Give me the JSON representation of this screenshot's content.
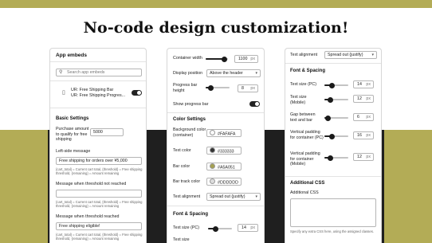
{
  "page": {
    "title": "No-code design customization!"
  },
  "panel1": {
    "title": "App embeds",
    "search_placeholder": "Search app embeds",
    "embed": {
      "title": "UR: Free Shipping Bar",
      "subtitle": "UR: Free Shipping Progres...",
      "enabled": true
    },
    "basic_settings": "Basic Settings",
    "purchase_label": "Purchase amount to qualify for free shipping",
    "purchase_value": "5000",
    "left_msg_label": "Left-side message",
    "left_msg_value": "Free shipping for orders over ¥5,000",
    "left_msg_help": "{cart_total} = Current cart total, {threshold} = Free shipping threshold, {remaining} = Amount remaining",
    "not_reached_label": "Message when threshold not reached",
    "not_reached_help": "{cart_total} = Current cart total, {threshold} = Free shipping threshold, {remaining} = Amount remaining",
    "reached_label": "Message when threshold reached",
    "reached_value": "Free shipping eligible!",
    "reached_help": "{cart_total} = Current cart total, {threshold} = Free shipping threshold, {remaining} = Amount remaining"
  },
  "panel2": {
    "container_width_label": "Container width",
    "container_width_value": "1100",
    "display_position_label": "Display position",
    "display_position_value": "Above the header",
    "progress_height_label": "Progress bar height",
    "progress_height_value": "8",
    "show_progress_label": "Show progress bar",
    "show_progress_enabled": true,
    "color_settings": "Color Settings",
    "bg_color_label": "Background color (container)",
    "bg_color_value": "#FAFAFA",
    "text_color_label": "Text color",
    "text_color_value": "#333333",
    "bar_color_label": "Bar color",
    "bar_color_value": "#A5A051",
    "bar_track_label": "Bar track color",
    "bar_track_value": "#DDDDDD",
    "text_align_label": "Text alignment",
    "text_align_value": "Spread out (justify)",
    "font_spacing": "Font & Spacing",
    "text_size_pc_label": "Text size (PC)",
    "text_size_pc_value": "14",
    "text_size_mobile_label": "Text size",
    "unit": "px"
  },
  "panel3": {
    "text_align_label": "Text alignment",
    "text_align_value": "Spread out (justify)",
    "font_spacing": "Font & Spacing",
    "text_size_pc_label": "Text size (PC)",
    "text_size_pc_value": "14",
    "text_size_mobile_label": "Text size (Mobile)",
    "text_size_mobile_value": "12",
    "gap_label": "Gap between text and bar",
    "gap_value": "6",
    "vpad_pc_label": "Vertical padding for container (PC)",
    "vpad_pc_value": "16",
    "vpad_mobile_label": "Vertical padding for container (Mobile)",
    "vpad_mobile_value": "12",
    "additional_css": "Additional CSS",
    "additional_css_label": "Additional CSS",
    "css_help": "Specify any extra CSS here, using the assigned classes.",
    "unit": "px"
  },
  "colors": {
    "gold": "#b3ac56",
    "dark": "#1f1f1f",
    "bg": "#FAFAFA",
    "text": "#333333",
    "bar": "#A5A051",
    "track": "#DDDDDD"
  },
  "icons": [
    "search-icon",
    "mobile-icon",
    "chevron-down-icon"
  ]
}
